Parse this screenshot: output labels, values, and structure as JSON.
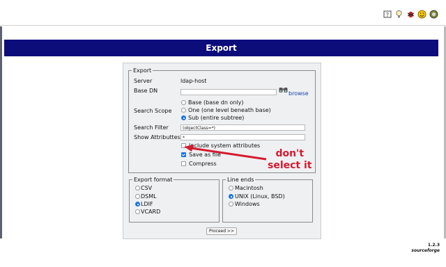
{
  "toolbar": {
    "icons": [
      "help-icon",
      "bulb-icon",
      "bug-icon",
      "smiley-icon",
      "sourceforge-icon"
    ]
  },
  "page": {
    "title": "Export"
  },
  "export": {
    "legend": "Export",
    "server_label": "Server",
    "server_value": "ldap-host",
    "base_dn_label": "Base DN",
    "base_dn_value": "",
    "browse_label": "browse",
    "search_scope_label": "Search Scope",
    "scope_options": [
      {
        "label": "Base (base dn only)",
        "selected": false
      },
      {
        "label": "One (one level beneath base)",
        "selected": false
      },
      {
        "label": "Sub (entire subtree)",
        "selected": true
      }
    ],
    "search_filter_label": "Search Filter",
    "search_filter_value": "(objectClass=*)",
    "show_attributes_label": "Show Attributtes",
    "show_attributes_value": "*",
    "options": [
      {
        "label": "Include system attributes",
        "checked": false
      },
      {
        "label": "Save as file",
        "checked": true
      },
      {
        "label": "Compress",
        "checked": false
      }
    ]
  },
  "export_format": {
    "legend": "Export format",
    "options": [
      {
        "label": "CSV",
        "selected": false
      },
      {
        "label": "DSML",
        "selected": false
      },
      {
        "label": "LDIF",
        "selected": true
      },
      {
        "label": "VCARD",
        "selected": false
      }
    ]
  },
  "line_ends": {
    "legend": "Line ends",
    "options": [
      {
        "label": "Macintosh",
        "selected": false
      },
      {
        "label": "UNIX (Linux, BSD)",
        "selected": true
      },
      {
        "label": "Windows",
        "selected": false
      }
    ]
  },
  "proceed_label": "Proceed >>",
  "footer": {
    "version": "1.2.3",
    "brand": "sourceforge"
  },
  "annotation": {
    "line1": "don't",
    "line2": "select it",
    "color": "#d61a2e"
  }
}
